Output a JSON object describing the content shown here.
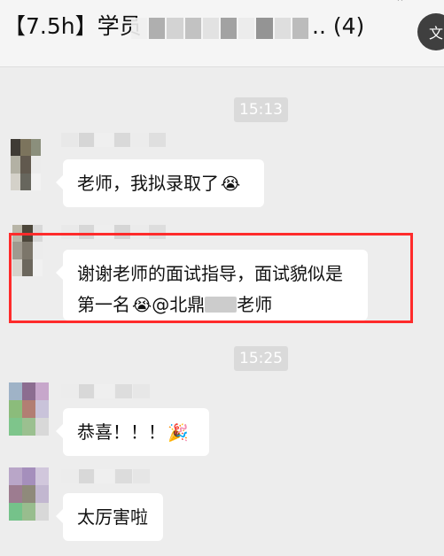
{
  "header": {
    "title_prefix": "【7.5h】学员",
    "title_suffix": "..  (4)",
    "translate_label": "文"
  },
  "messages": [
    {
      "type": "timestamp",
      "text": "15:13"
    },
    {
      "type": "bubble",
      "text": "老师，我拟录取了",
      "emoji": "😭"
    },
    {
      "type": "bubble",
      "line1": "谢谢老师的面试指导，面试貌似是",
      "line2_prefix": "第一名",
      "line2_emoji": "😭",
      "line2_mention": "@北鼎",
      "line2_suffix": "老师"
    },
    {
      "type": "timestamp",
      "text": "15:25"
    },
    {
      "type": "bubble",
      "text": "恭喜！！！",
      "emoji": "🎉"
    },
    {
      "type": "bubble",
      "text": "太厉害啦"
    }
  ],
  "colors": {
    "highlight": "#ff2b2b",
    "background": "#ededed",
    "bubble": "#ffffff"
  },
  "icons": [
    "pin-icon",
    "translate-icon",
    "crying-emoji",
    "party-popper-emoji"
  ]
}
